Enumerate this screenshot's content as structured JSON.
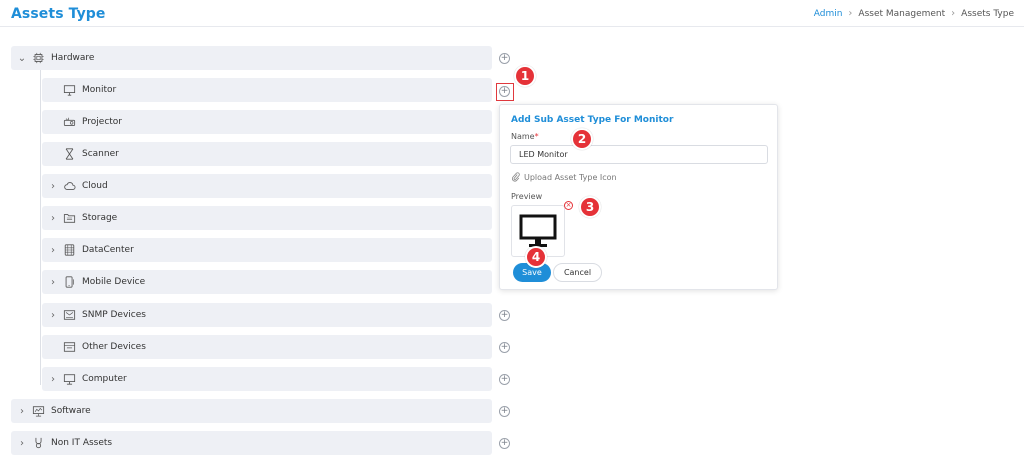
{
  "header": {
    "title": "Assets Type",
    "breadcrumb": [
      "Admin",
      "Asset Management",
      "Assets Type"
    ]
  },
  "tree": {
    "hardware": "Hardware",
    "monitor": "Monitor",
    "projector": "Projector",
    "scanner": "Scanner",
    "cloud": "Cloud",
    "storage": "Storage",
    "datacenter": "DataCenter",
    "mobile": "Mobile Device",
    "snmp": "SNMP Devices",
    "other": "Other Devices",
    "computer": "Computer",
    "software": "Software",
    "non_it": "Non IT Assets"
  },
  "panel": {
    "title": "Add Sub Asset Type For Monitor",
    "name_label": "Name",
    "required_mark": "*",
    "name_value": "LED Monitor",
    "upload_label": "Upload Asset Type Icon",
    "preview_label": "Preview",
    "save_label": "Save",
    "cancel_label": "Cancel"
  },
  "callouts": [
    "1",
    "2",
    "3",
    "4"
  ],
  "icons": {
    "plus": "+",
    "remove": "×"
  },
  "colors": {
    "accent": "#1f8ed8",
    "callout": "#e53238",
    "row_bg": "#eef0f5"
  }
}
